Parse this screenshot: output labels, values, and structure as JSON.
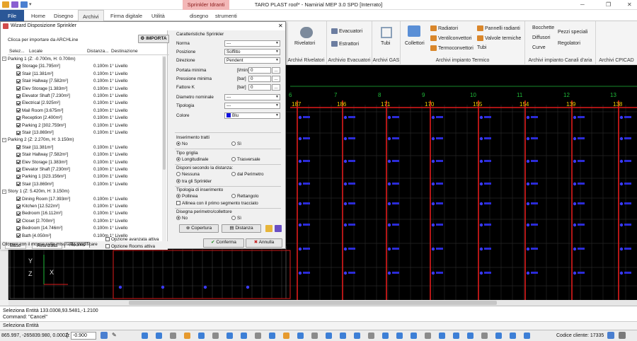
{
  "window": {
    "title": "TARO PLAST roof* - Namirial MEP 3.0 SPD [Interrato]",
    "context_tab_group": "Sprinkler Idranti"
  },
  "tabs": [
    "File",
    "Home",
    "Disegno",
    "Archivi",
    "Firma digitale",
    "Utilità",
    "disegno",
    "strumenti"
  ],
  "ribbon": {
    "groups": [
      {
        "label": "Archivi Rivelatori",
        "items": [
          "Rivelatori"
        ]
      },
      {
        "label": "Archivio Evacuatori",
        "items": [
          "Evacuatori",
          "Estrattori"
        ]
      },
      {
        "label": "Archivi GAS",
        "items": [
          "Tubi"
        ]
      },
      {
        "label": "Archivi impianto Termico",
        "items": [
          "Collettori",
          "Radiatori",
          "Ventilconvettori",
          "Termoconvettori",
          "Pannelli radianti",
          "Valvole termiche",
          "Tubi"
        ]
      },
      {
        "label": "Archivi impianto Canali d'aria",
        "items": [
          "Bocchette",
          "Diffusori",
          "Curve",
          "Pezzi speciali",
          "Regolatori"
        ]
      },
      {
        "label": "Archivi CPICAD",
        "items": []
      }
    ]
  },
  "wizard": {
    "title": "Wizard Disposizione Sprinkler",
    "import_prompt": "Clicca per importare da ARCHLine",
    "import_button": "IMPORTA",
    "columns": [
      "Selez...",
      "Locale",
      "Distanza...",
      "Destinazione"
    ],
    "tree": [
      {
        "type": "group",
        "label": "Parking 1 (Z: -0.700m, H: 0.700m)"
      },
      {
        "type": "item",
        "label": "Storage [31.795m²]",
        "distance": "0.100m",
        "dest": "1° Livello"
      },
      {
        "type": "item",
        "label": "Stair [11.381m²]",
        "distance": "0.100m",
        "dest": "1° Livello"
      },
      {
        "type": "item",
        "label": "Stair Hallway [7.582m²]",
        "distance": "0.100m",
        "dest": "1° Livello"
      },
      {
        "type": "item",
        "label": "Elev Storage [1.383m²]",
        "distance": "0.100m",
        "dest": "1° Livello"
      },
      {
        "type": "item",
        "label": "Elevator Shaft [7.230m²]",
        "distance": "0.100m",
        "dest": "1° Livello"
      },
      {
        "type": "item",
        "label": "Electrical [2.925m²]",
        "distance": "0.100m",
        "dest": "1° Livello"
      },
      {
        "type": "item",
        "label": "Mail Room [3.675m²]",
        "distance": "0.100m",
        "dest": "1° Livello"
      },
      {
        "type": "item",
        "label": "Reception [2.400m²]",
        "distance": "0.100m",
        "dest": "1° Livello"
      },
      {
        "type": "item",
        "label": "Parking 2 [302.759m²]",
        "distance": "0.100m",
        "dest": "1° Livello"
      },
      {
        "type": "item",
        "label": "Stair [13.869m²]",
        "distance": "0.100m",
        "dest": "1° Livello"
      },
      {
        "type": "group",
        "label": "Parking 2 (Z: 2.270m, H: 3.150m)"
      },
      {
        "type": "item",
        "label": "Stair [11.381m²]",
        "distance": "0.100m",
        "dest": "1° Livello"
      },
      {
        "type": "item",
        "label": "Stair Hallway [7.582m²]",
        "distance": "0.100m",
        "dest": "1° Livello"
      },
      {
        "type": "item",
        "label": "Elev Storage [1.383m²]",
        "distance": "0.100m",
        "dest": "1° Livello"
      },
      {
        "type": "item",
        "label": "Elevator Shaft [7.230m²]",
        "distance": "0.100m",
        "dest": "1° Livello"
      },
      {
        "type": "item",
        "label": "Parking 1 [323.156m²]",
        "distance": "0.100m",
        "dest": "1° Livello"
      },
      {
        "type": "item",
        "label": "Stair [13.869m²]",
        "distance": "0.100m",
        "dest": "1° Livello"
      },
      {
        "type": "group",
        "label": "Story 1 (Z: 5.420m, H: 3.150m)"
      },
      {
        "type": "item",
        "label": "Dining Room [17.393m²]",
        "distance": "0.100m",
        "dest": "1° Livello"
      },
      {
        "type": "item",
        "label": "Kitchen [12.522m²]",
        "distance": "0.100m",
        "dest": "1° Livello"
      },
      {
        "type": "item",
        "label": "Bedroom [16.112m²]",
        "distance": "0.100m",
        "dest": "1° Livello"
      },
      {
        "type": "item",
        "label": "Closet [2.700m²]",
        "distance": "0.100m",
        "dest": "1° Livello"
      },
      {
        "type": "item",
        "label": "Bedroom [14.746m²]",
        "distance": "0.100m",
        "dest": "1° Livello"
      },
      {
        "type": "item",
        "label": "Bath [4.050m²]",
        "distance": "0.100m",
        "dest": "1° Livello"
      }
    ],
    "bottom_tabs": [
      "Base",
      "Avanzata",
      "Rooms"
    ],
    "hint": "Cliccare con il mouse sulla misura da modificare",
    "checks": [
      {
        "label": "Opzione avanzata attiva",
        "checked": false
      },
      {
        "label": "Opzione Rooms attiva",
        "checked": false
      }
    ],
    "props": {
      "heading": "Caratteristiche Sprinkler",
      "fields": [
        {
          "label": "Norma",
          "value": "---",
          "unit": "",
          "kind": "select"
        },
        {
          "label": "Posizione",
          "value": "Soffitto",
          "unit": "",
          "kind": "select"
        },
        {
          "label": "Direzione",
          "value": "Pendent",
          "unit": "",
          "kind": "select"
        },
        {
          "label": "Portata minima",
          "value": "0",
          "unit": "[l/min]",
          "kind": "num"
        },
        {
          "label": "Pressione minima",
          "value": "0",
          "unit": "[bar]",
          "kind": "num"
        },
        {
          "label": "Fattore K",
          "value": "0",
          "unit": "[bar]",
          "kind": "num"
        },
        {
          "label": "Diametro nominale",
          "value": "---",
          "unit": "",
          "kind": "select"
        },
        {
          "label": "Tipologia",
          "value": "---",
          "unit": "",
          "kind": "select"
        },
        {
          "label": "Colore",
          "value": "Blu",
          "unit": "",
          "kind": "color"
        }
      ],
      "inserimento_tratti": {
        "label": "Inserimento tratti",
        "options": [
          "No",
          "Sì"
        ],
        "selected": 0
      },
      "tipo_griglia": {
        "label": "Tipo griglia",
        "options": [
          "Longitudinale",
          "Trasversale"
        ],
        "selected": 0
      },
      "disponi": {
        "label": "Disponi secondo la distanza:",
        "options": [
          "Nessuna",
          "dal Perimetro",
          "tra gli Sprinkler"
        ],
        "selected": 2
      },
      "tipologia_ins": {
        "label": "Tipologia di inserimento",
        "options": [
          "Pollinea",
          "Rettangolo"
        ],
        "selected": 0
      },
      "allinea": "Allinea con il primo segmento tracciato",
      "disegna": {
        "label": "Disegna perimetro/collettore",
        "options": [
          "No",
          "Sì"
        ],
        "selected": 0
      },
      "buttons": {
        "copertura": "Copertura",
        "distanza": "Distanza"
      }
    },
    "confirm": "Conferma",
    "cancel": "Annulla"
  },
  "cad": {
    "grid_numbers": [
      "6",
      "7",
      "8",
      "9",
      "10",
      "11",
      "12",
      "13"
    ],
    "column_values": [
      "187",
      "186",
      "171",
      "170",
      "155",
      "154",
      "139",
      "138"
    ]
  },
  "command": {
    "line1": "Seleziona Entità 133.0308,93.5481,-1.2100",
    "line2": "Command: \"Cancel\"",
    "selection": "Seleziona Entità"
  },
  "status": {
    "coords": "865.997, -265839.980, 0.000 [r",
    "z_label": "Z:",
    "z_value": "-0.900",
    "client_code": "Codice cliente: 17335"
  },
  "colors": {
    "accent": "#2b5797",
    "context_tab": "#f3b7b7",
    "sprinkler": "#3a3aff",
    "pipe": "#e01b1b",
    "gridlabel": "#f2d100"
  }
}
